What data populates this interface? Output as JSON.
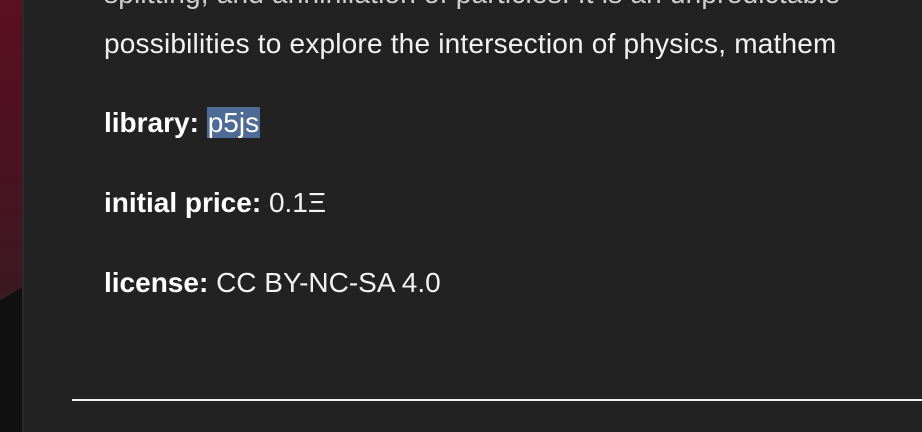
{
  "description": {
    "line_top_cut": "splitting, and annihilation of particles. It is an unpredictable",
    "line_visible": "possibilities to explore the intersection of physics, mathem"
  },
  "meta": {
    "library": {
      "key": "library:",
      "value": "p5js"
    },
    "initial_price": {
      "key": "initial price:",
      "value": "0.1Ξ"
    },
    "license": {
      "key": "license:",
      "value": "CC BY-NC-SA 4.0"
    }
  },
  "colors": {
    "background": "#222222",
    "selection": "#4d6b94",
    "accent_strip": "#5a1021"
  }
}
